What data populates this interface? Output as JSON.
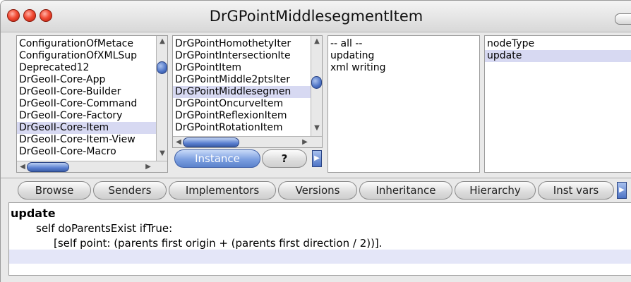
{
  "window": {
    "title": "DrGPointMiddlesegmentItem"
  },
  "packages": {
    "items": [
      "ConfigurationOfMetace",
      "ConfigurationOfXMLSup",
      "Deprecated12",
      "DrGeoII-Core-App",
      "DrGeoII-Core-Builder",
      "DrGeoII-Core-Command",
      "DrGeoII-Core-Factory",
      "DrGeoII-Core-Item",
      "DrGeoII-Core-Item-View",
      "DrGeoII-Core-Macro"
    ],
    "selected_index": 7
  },
  "classes": {
    "items": [
      "DrGPointHomothetyIter",
      "DrGPointIntersectionIte",
      "DrGPointItem",
      "DrGPointMiddle2ptsIter",
      "DrGPointMiddlesegmen",
      "DrGPointOncurveItem",
      "DrGPointReflexionItem",
      "DrGPointRotationItem"
    ],
    "selected_index": 4,
    "instance_label": "Instance",
    "class_label": "?"
  },
  "categories": {
    "items": [
      "-- all --",
      "updating",
      "xml writing"
    ]
  },
  "methods": {
    "items": [
      "nodeType",
      "update"
    ],
    "selected_index": 1
  },
  "toolbar": {
    "buttons": [
      "Browse",
      "Senders",
      "Implementors",
      "Versions",
      "Inheritance",
      "Hierarchy",
      "Inst vars"
    ]
  },
  "code": {
    "method_name": "update",
    "line1": "self doParentsExist ifTrue:",
    "line2": "[self point: (parents first origin + (parents first direction / 2))]."
  },
  "colors": {
    "selection": "#d7d9f2",
    "accent_blue": "#4d73c5",
    "window_bg": "#e9e9e9"
  }
}
